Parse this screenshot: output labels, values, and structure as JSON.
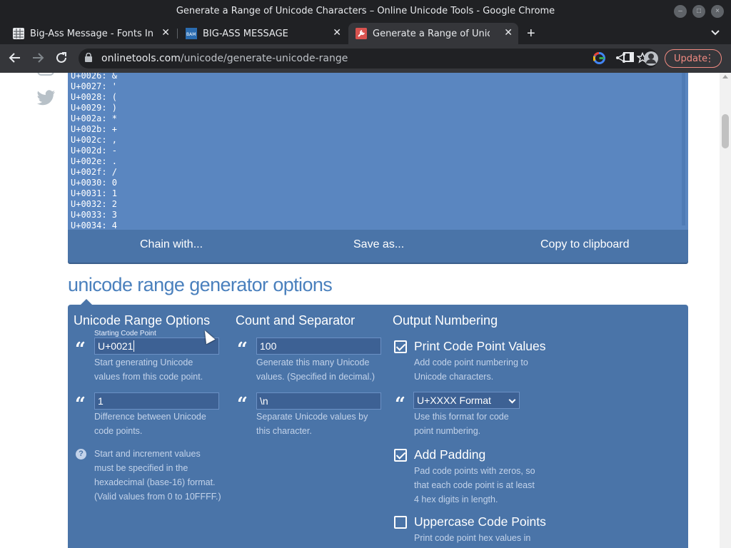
{
  "window": {
    "title": "Generate a Range of Unicode Characters – Online Unicode Tools - Google Chrome"
  },
  "tabs": [
    {
      "label": "Big-Ass Message - Fonts In Us",
      "favicon": "grid-favicon-icon",
      "color": "#5f6368",
      "active": false
    },
    {
      "label": "BIG-ASS MESSAGE",
      "favicon": "bam-favicon-icon",
      "color": "#2b6cb0",
      "active": false
    },
    {
      "label": "Generate a Range of Unicode C",
      "favicon": "wrench-favicon-icon",
      "color": "#d9534f",
      "active": true
    }
  ],
  "toolbar": {
    "url_host": "onlinetools.com",
    "url_path": "/unicode/generate-unicode-range",
    "update_label": "Update"
  },
  "output": {
    "lines": [
      "U+0026: &",
      "U+0027: '",
      "U+0028: (",
      "U+0029: )",
      "U+002a: *",
      "U+002b: +",
      "U+002c: ,",
      "U+002d: -",
      "U+002e: .",
      "U+002f: /",
      "U+0030: 0",
      "U+0031: 1",
      "U+0032: 2",
      "U+0033: 3",
      "U+0034: 4"
    ],
    "actions": {
      "chain": "Chain with...",
      "save": "Save as...",
      "copy": "Copy to clipboard"
    }
  },
  "options": {
    "heading": "unicode range generator options",
    "col1": {
      "title": "Unicode Range Options",
      "start_label": "Starting Code Point",
      "start_value": "U+0021",
      "start_hint_1": "Start generating Unicode",
      "start_hint_2": "values from this code point.",
      "increment_value": "1",
      "increment_hint_1": "Difference between Unicode",
      "increment_hint_2": "code points.",
      "help_1": "Start and increment values",
      "help_2": "must be specified in the",
      "help_3": "hexadecimal (base-16) format.",
      "help_4": "(Valid values from 0 to 10FFFF.)"
    },
    "col2": {
      "title": "Count and Separator",
      "count_value": "100",
      "count_hint_1": "Generate this many Unicode",
      "count_hint_2": "values. (Specified in decimal.)",
      "separator_value": "\\n",
      "separator_hint_1": "Separate Unicode values by",
      "separator_hint_2": "this character."
    },
    "col3": {
      "title": "Output Numbering",
      "print_label": "Print Code Point Values",
      "print_checked": true,
      "print_hint_1": "Add code point numbering to",
      "print_hint_2": "Unicode characters.",
      "format_selected": "U+XXXX Format",
      "format_hint_1": "Use this format for code",
      "format_hint_2": "point numbering.",
      "padding_label": "Add Padding",
      "padding_checked": true,
      "padding_hint_1": "Pad code points with zeros, so",
      "padding_hint_2": "that each code point is at least",
      "padding_hint_3": "4 hex digits in length.",
      "upper_label": "Uppercase Code Points",
      "upper_checked": false,
      "upper_hint_1": "Print code point hex values in"
    }
  }
}
